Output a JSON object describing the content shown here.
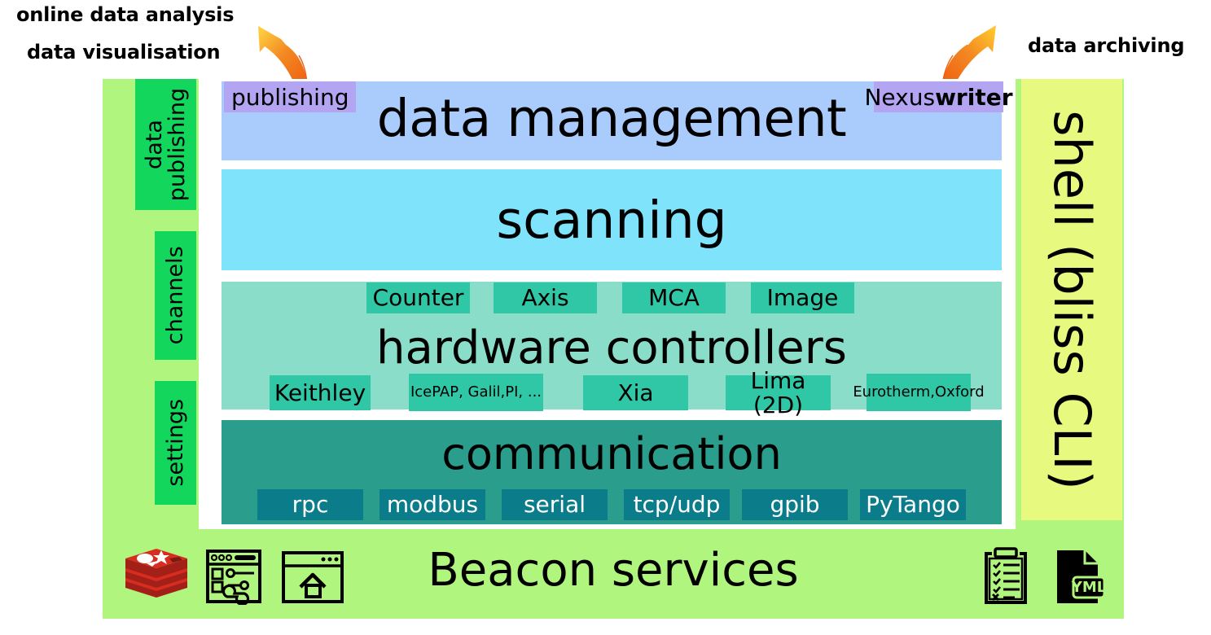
{
  "callouts": {
    "online_analysis": "online data analysis",
    "data_visualisation": "data visualisation",
    "data_archiving": "data archiving"
  },
  "left_rail": {
    "items": [
      {
        "label": "data publishing",
        "line1": "data",
        "line2": "publishing"
      },
      {
        "label": "channels"
      },
      {
        "label": "settings"
      }
    ]
  },
  "right_rail": {
    "label": "shell (bliss CLI)"
  },
  "layers": [
    {
      "id": "data-management",
      "title": "data management",
      "color": "#aaccfc",
      "badges": [
        {
          "label": "publishing",
          "color": "#b3a5f2"
        },
        {
          "label": "Nexus writer",
          "part1": "Nexus",
          "part2": "writer",
          "color": "#b3a5f2"
        }
      ]
    },
    {
      "id": "scanning",
      "title": "scanning",
      "color": "#7fe4fb",
      "badges": []
    },
    {
      "id": "hardware-controllers",
      "title": "hardware controllers",
      "color": "#8adec9",
      "top_chips": [
        "Counter",
        "Axis",
        "MCA",
        "Image"
      ],
      "bottom_chips": [
        "Keithley",
        "IcePAP, Galil, PI, ...",
        "Xia",
        "Lima (2D)",
        "Eurotherm, Oxford"
      ]
    },
    {
      "id": "communication",
      "title": "communication",
      "color": "#2a9d8c",
      "chips": [
        "rpc",
        "modbus",
        "serial",
        "tcp/udp",
        "gpib",
        "PyTango"
      ]
    }
  ],
  "chips": {
    "counter": "Counter",
    "axis": "Axis",
    "mca": "MCA",
    "image": "Image",
    "keithley": "Keithley",
    "icepap_l1": "IcePAP, Galil,",
    "icepap_l2": "PI, ...",
    "xia": "Xia",
    "lima": "Lima (2D)",
    "eurotherm_l1": "Eurotherm,",
    "eurotherm_l2": "Oxford",
    "rpc": "rpc",
    "modbus": "modbus",
    "serial": "serial",
    "tcpudp": "tcp/udp",
    "gpib": "gpib",
    "pytango": "PyTango"
  },
  "beacon": {
    "title": "Beacon services",
    "color": "#b0f57e",
    "icons": [
      "redis-logo-icon",
      "config-window-icon",
      "homepage-window-icon",
      "checklist-clipboard-icon",
      "yml-file-icon"
    ],
    "yml_label": "YML"
  },
  "colors": {
    "frame_green": "#b0f57e",
    "rail_green": "#13d75c",
    "shell_yellow": "#e7f97e",
    "badge_purple": "#b3a5f2",
    "chip_teal": "#2fc7a5",
    "chip_comm": "#0b7c8a",
    "arrow_orange": "#f07c20",
    "arrow_yellow": "#ffc83c",
    "redis_red": "#d82c20"
  }
}
